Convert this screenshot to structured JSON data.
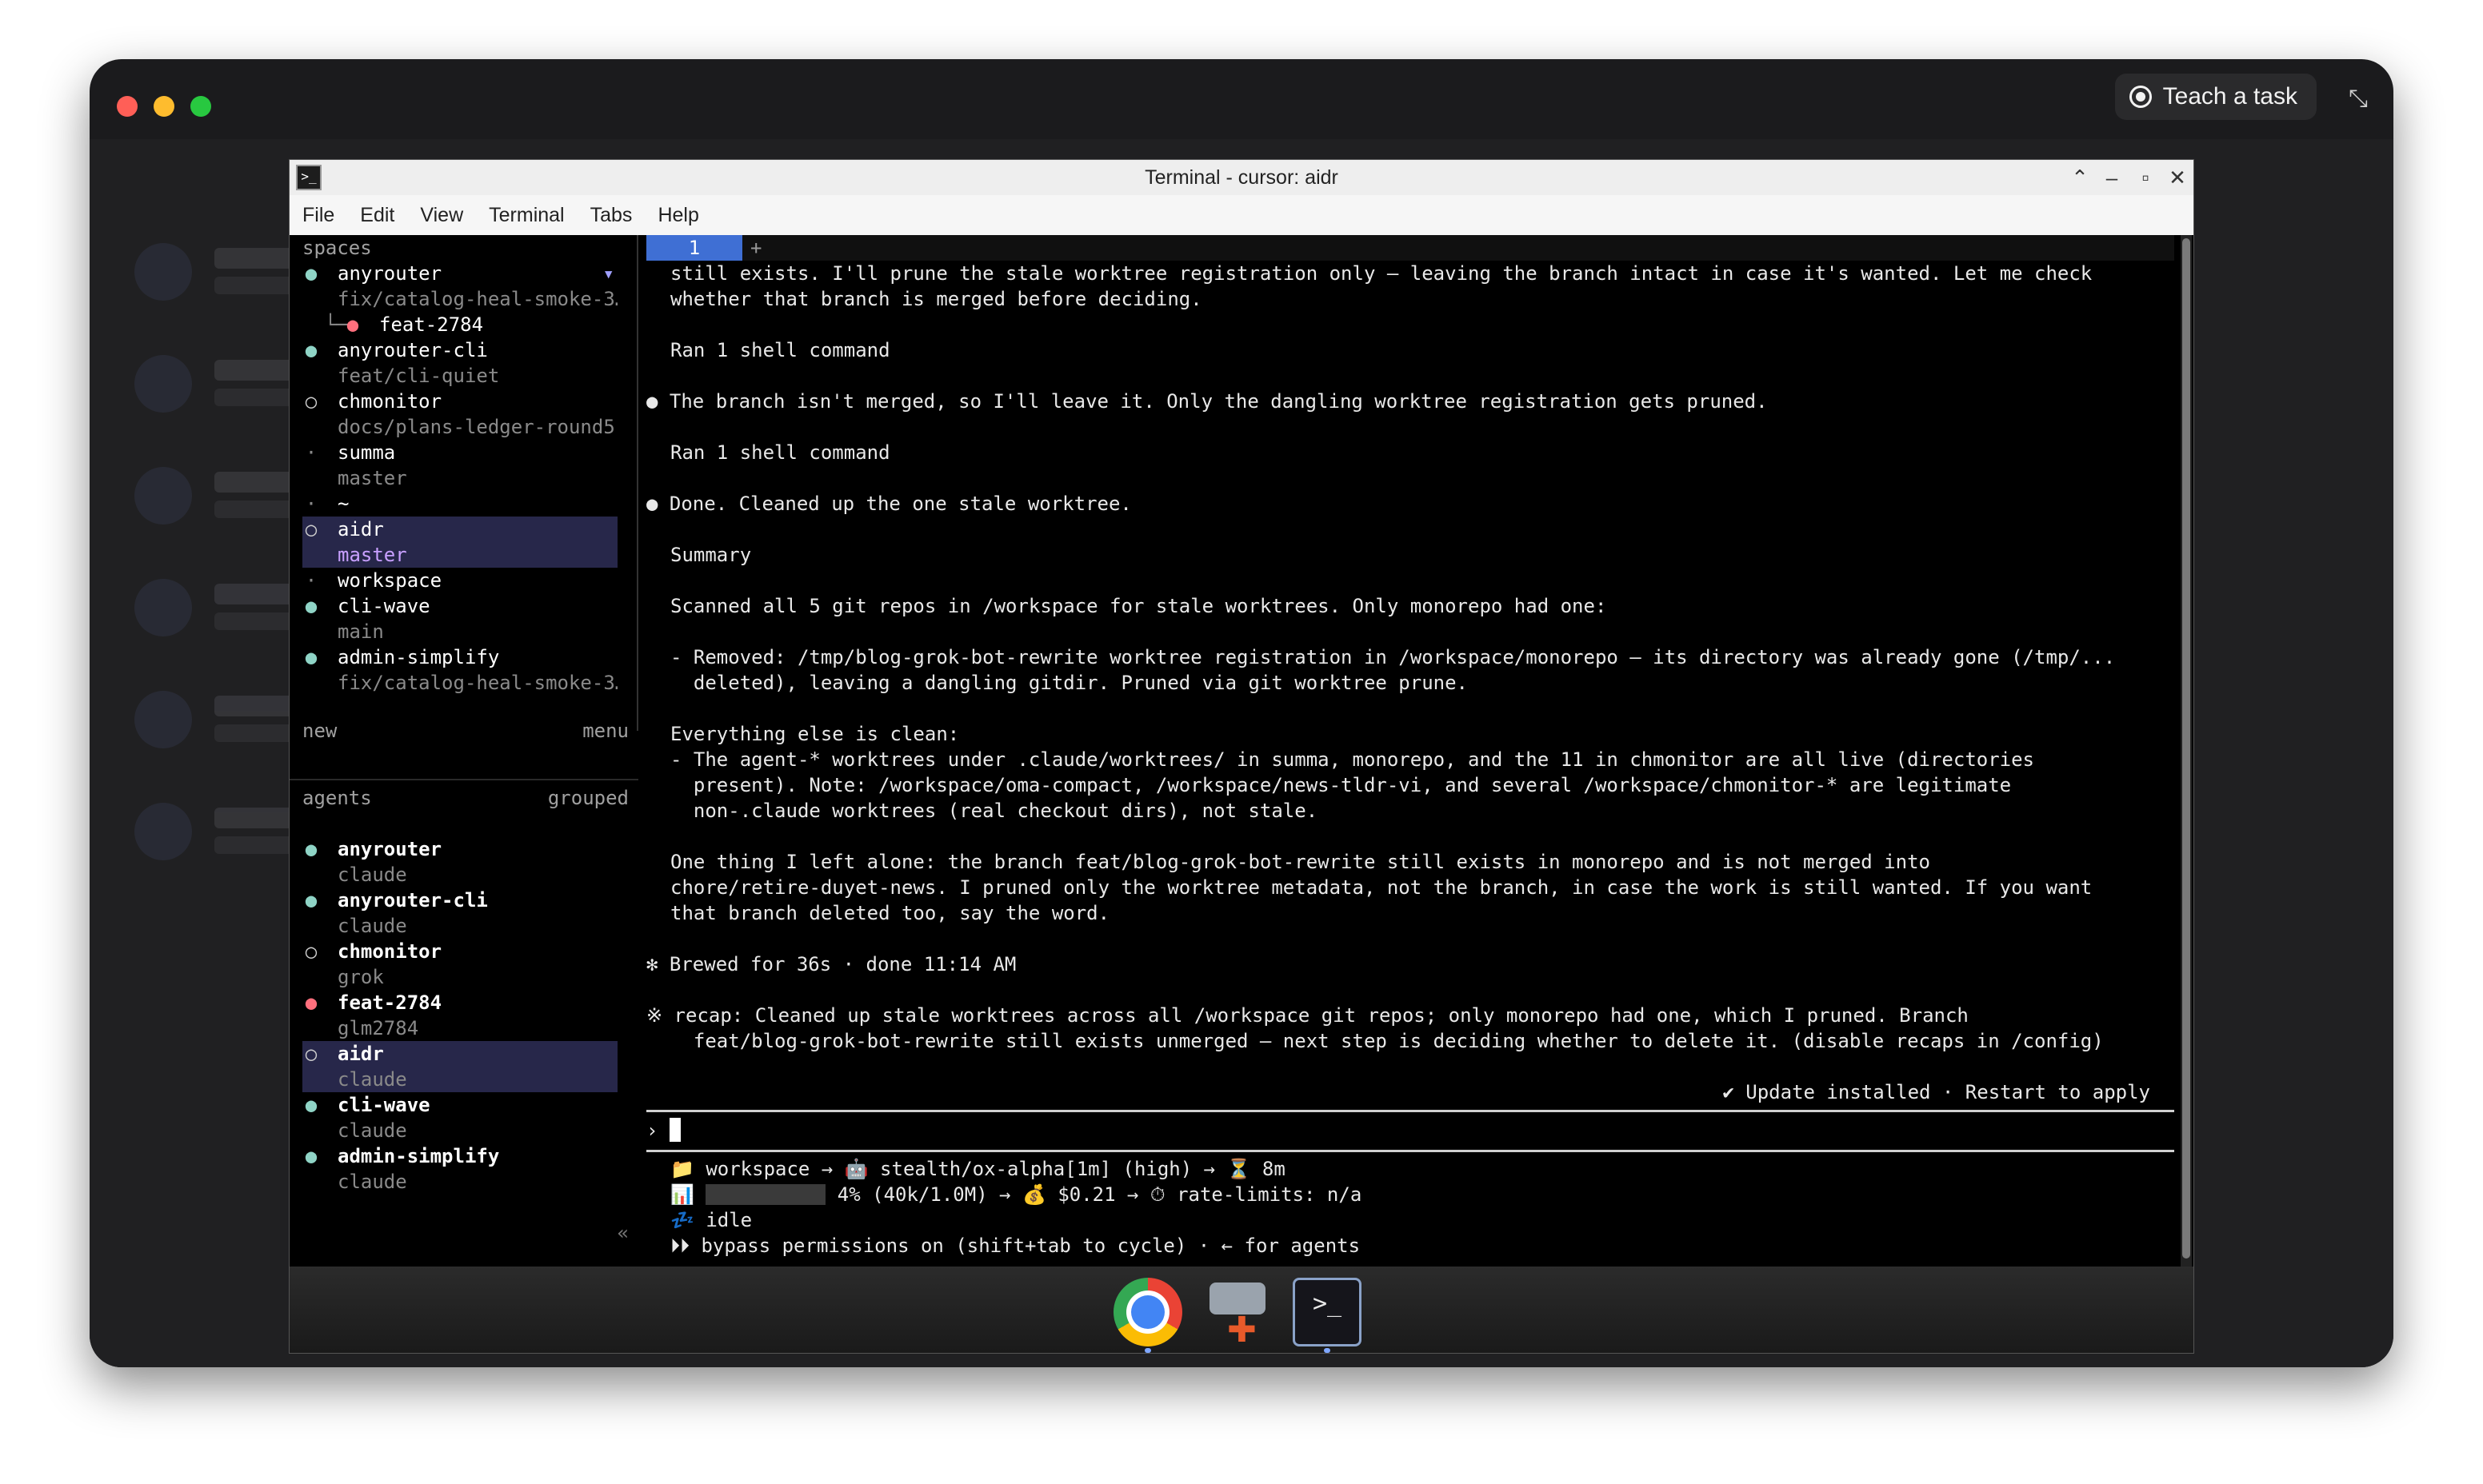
{
  "mac": {
    "teach_label": "Teach a task"
  },
  "window": {
    "title": "Terminal - cursor: aidr",
    "menu": [
      "File",
      "Edit",
      "View",
      "Terminal",
      "Tabs",
      "Help"
    ]
  },
  "sidebar": {
    "spaces_label": "spaces",
    "spaces": [
      {
        "dot": "●",
        "dot_color": "#8fd4c6",
        "name": "anyrouter",
        "caret": "▾"
      },
      {
        "sub": "fix/catalog-heal-smoke-3…"
      },
      {
        "tree": "└─",
        "dot": "●",
        "dot_color": "#ff6f7d",
        "name": "feat-2784"
      },
      {
        "dot": "●",
        "dot_color": "#8fd4c6",
        "name": "anyrouter-cli"
      },
      {
        "sub": "feat/cli-quiet"
      },
      {
        "dot": "○",
        "dot_color": "#cfcfcf",
        "name": "chmonitor"
      },
      {
        "sub": "docs/plans-ledger-round5"
      },
      {
        "dot": "·",
        "dot_color": "#8a8a8a",
        "name": "summa"
      },
      {
        "sub": "master"
      },
      {
        "dot": "·",
        "dot_color": "#8a8a8a",
        "name": "~"
      },
      {
        "dot": "○",
        "dot_color": "#cfcfcf",
        "name": "aidr",
        "selected": true
      },
      {
        "sub": "master",
        "selected": true
      },
      {
        "dot": "·",
        "dot_color": "#8a8a8a",
        "name": "workspace"
      },
      {
        "dot": "●",
        "dot_color": "#8fd4c6",
        "name": "cli-wave"
      },
      {
        "sub": "main"
      },
      {
        "dot": "●",
        "dot_color": "#8fd4c6",
        "name": "admin-simplify"
      },
      {
        "sub": "fix/catalog-heal-smoke-3…"
      }
    ],
    "new_label": "new",
    "menu_label": "menu",
    "agents_label": "agents",
    "grouped_label": "grouped",
    "agents": [
      {
        "dot": "●",
        "dot_color": "#8fd4c6",
        "name": "anyrouter",
        "sub": "claude"
      },
      {
        "dot": "●",
        "dot_color": "#8fd4c6",
        "name": "anyrouter-cli",
        "sub": "claude"
      },
      {
        "dot": "○",
        "dot_color": "#cfcfcf",
        "name": "chmonitor",
        "sub": "grok"
      },
      {
        "dot": "●",
        "dot_color": "#ff6f7d",
        "name": "feat-2784",
        "sub": "glm2784"
      },
      {
        "dot": "○",
        "dot_color": "#cfcfcf",
        "name": "aidr",
        "sub": "claude",
        "selected": true
      },
      {
        "dot": "●",
        "dot_color": "#8fd4c6",
        "name": "cli-wave",
        "sub": "claude"
      },
      {
        "dot": "●",
        "dot_color": "#8fd4c6",
        "name": "admin-simplify",
        "sub": "claude"
      }
    ],
    "collapse_glyph": "«"
  },
  "tabs": {
    "active": "1",
    "add": "+"
  },
  "output": [
    "still exists. I'll prune the stale worktree registration only — leaving the branch intact in case it's wanted. Let me check",
    "whether that branch is merged before deciding.",
    "",
    "Ran 1 shell command",
    "",
    "● The branch isn't merged, so I'll leave it. Only the dangling worktree registration gets pruned.",
    "",
    "Ran 1 shell command",
    "",
    "● Done. Cleaned up the one stale worktree.",
    "",
    "Summary",
    "",
    "Scanned all 5 git repos in /workspace for stale worktrees. Only monorepo had one:",
    "",
    "- Removed: /tmp/blog-grok-bot-rewrite worktree registration in /workspace/monorepo — its directory was already gone (/tmp/...",
    "  deleted), leaving a dangling gitdir. Pruned via git worktree prune.",
    "",
    "Everything else is clean:",
    "- The agent-* worktrees under .claude/worktrees/ in summa, monorepo, and the 11 in chmonitor are all live (directories",
    "  present). Note: /workspace/oma-compact, /workspace/news-tldr-vi, and several /workspace/chmonitor-* are legitimate",
    "  non-.claude worktrees (real checkout dirs), not stale.",
    "",
    "One thing I left alone: the branch feat/blog-grok-bot-rewrite still exists in monorepo and is not merged into",
    "chore/retire-duyet-news. I pruned only the worktree metadata, not the branch, in case the work is still wanted. If you want",
    "that branch deleted too, say the word.",
    "",
    "✻ Brewed for 36s · done 11:14 AM",
    "",
    "※ recap: Cleaned up stale worktrees across all /workspace git repos; only monorepo had one, which I pruned. Branch",
    "  feat/blog-grok-bot-rewrite still exists unmerged — next step is deciding whether to delete it. (disable recaps in /config)"
  ],
  "update_notice": "✔ Update installed · Restart to apply",
  "prompt_glyph": "›",
  "status": {
    "line1": "📁 workspace → 🤖 stealth/ox-alpha[1m] (high) → ⏳ 8m",
    "line2_icon": "📊",
    "line2_text": "4% (40k/1.0M) → 💰 $0.21 → ⏱ rate-limits: n/a",
    "context_used_percent": 4,
    "line3": "💤 idle",
    "line4": "⏵⏵ bypass permissions on (shift+tab to cycle) · ← for agents"
  },
  "dock": [
    "chrome-icon",
    "game-icon",
    "terminal-icon"
  ],
  "colors": {
    "accent_tab": "#3f6fd4",
    "selection": "#27274a",
    "active_dot": "#8fd4c6",
    "error_dot": "#ff6f7d"
  }
}
